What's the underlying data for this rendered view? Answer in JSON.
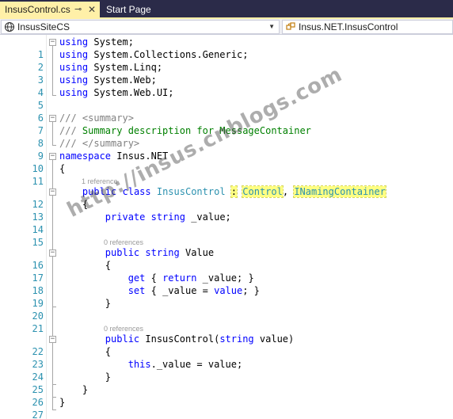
{
  "tabs": [
    {
      "label": "InsusControl.cs",
      "pin_glyph": "⊸",
      "close_glyph": "✕",
      "active": true
    },
    {
      "label": "Start Page",
      "active": false
    }
  ],
  "nav": {
    "project": "InsusSiteCS",
    "type": "Insus.NET.InsusControl"
  },
  "code": {
    "line_numbers": [
      "1",
      "2",
      "3",
      "4",
      "5",
      "6",
      "7",
      "8",
      "9",
      "10",
      "11",
      "12",
      "13",
      "14",
      "15",
      "16",
      "17",
      "18",
      "19",
      "20",
      "21",
      "22",
      "23",
      "24",
      "25",
      "26",
      "27"
    ],
    "line1": {
      "kw": "using",
      "rest": " System;"
    },
    "line2": {
      "kw": "using",
      "rest": " System.Collections.Generic;"
    },
    "line3": {
      "kw": "using",
      "rest": " System.Linq;"
    },
    "line4": {
      "kw": "using",
      "rest": " System.Web;"
    },
    "line5": {
      "kw": "using",
      "rest": " System.Web.UI;"
    },
    "line7": {
      "slashes": "///",
      "tag": " <summary>"
    },
    "line8": {
      "slashes": "///",
      "text": " Summary description for MessageContainer"
    },
    "line9": {
      "slashes": "///",
      "tag": " </summary>"
    },
    "line10": {
      "kw": "namespace",
      "rest": " Insus.NET"
    },
    "line11": {
      "text": "{"
    },
    "lens12": "1 reference",
    "line12": {
      "kw1": "public",
      "kw2": "class",
      "type": "InsusControl",
      "colon": ":",
      "base1": "Control",
      "comma": ",",
      "base2": "INamingContainer"
    },
    "line13": {
      "text": "{"
    },
    "line14": {
      "kw1": "private",
      "kw2": "string",
      "rest": " _value;"
    },
    "lens16": "0 references",
    "line16": {
      "kw1": "public",
      "kw2": "string",
      "rest": " Value"
    },
    "line17": {
      "text": "{"
    },
    "line18": {
      "kw1": "get",
      "p1": " { ",
      "kw2": "return",
      "p2": " _value; }"
    },
    "line19": {
      "kw1": "set",
      "p1": " { _value = ",
      "kw2": "value",
      "p2": "; }"
    },
    "line20": {
      "text": "}"
    },
    "lens22": "0 references",
    "line22": {
      "kw1": "public",
      "mid": " InsusControl(",
      "kw2": "string",
      "rest": " value)"
    },
    "line23": {
      "text": "{"
    },
    "line24": {
      "kw1": "this",
      "rest": "._value = value;"
    },
    "line25": {
      "text": "}"
    },
    "line26": {
      "text": "}"
    },
    "line27": {
      "text": "}"
    }
  },
  "watermark": "http://insus.cnblogs.com",
  "colors": {
    "keyword": "#0000ff",
    "type": "#2b91af",
    "comment": "#008000",
    "highlight": "#ffff82",
    "tab_active": "#fff0a8",
    "tab_strip": "#2b2b49"
  }
}
